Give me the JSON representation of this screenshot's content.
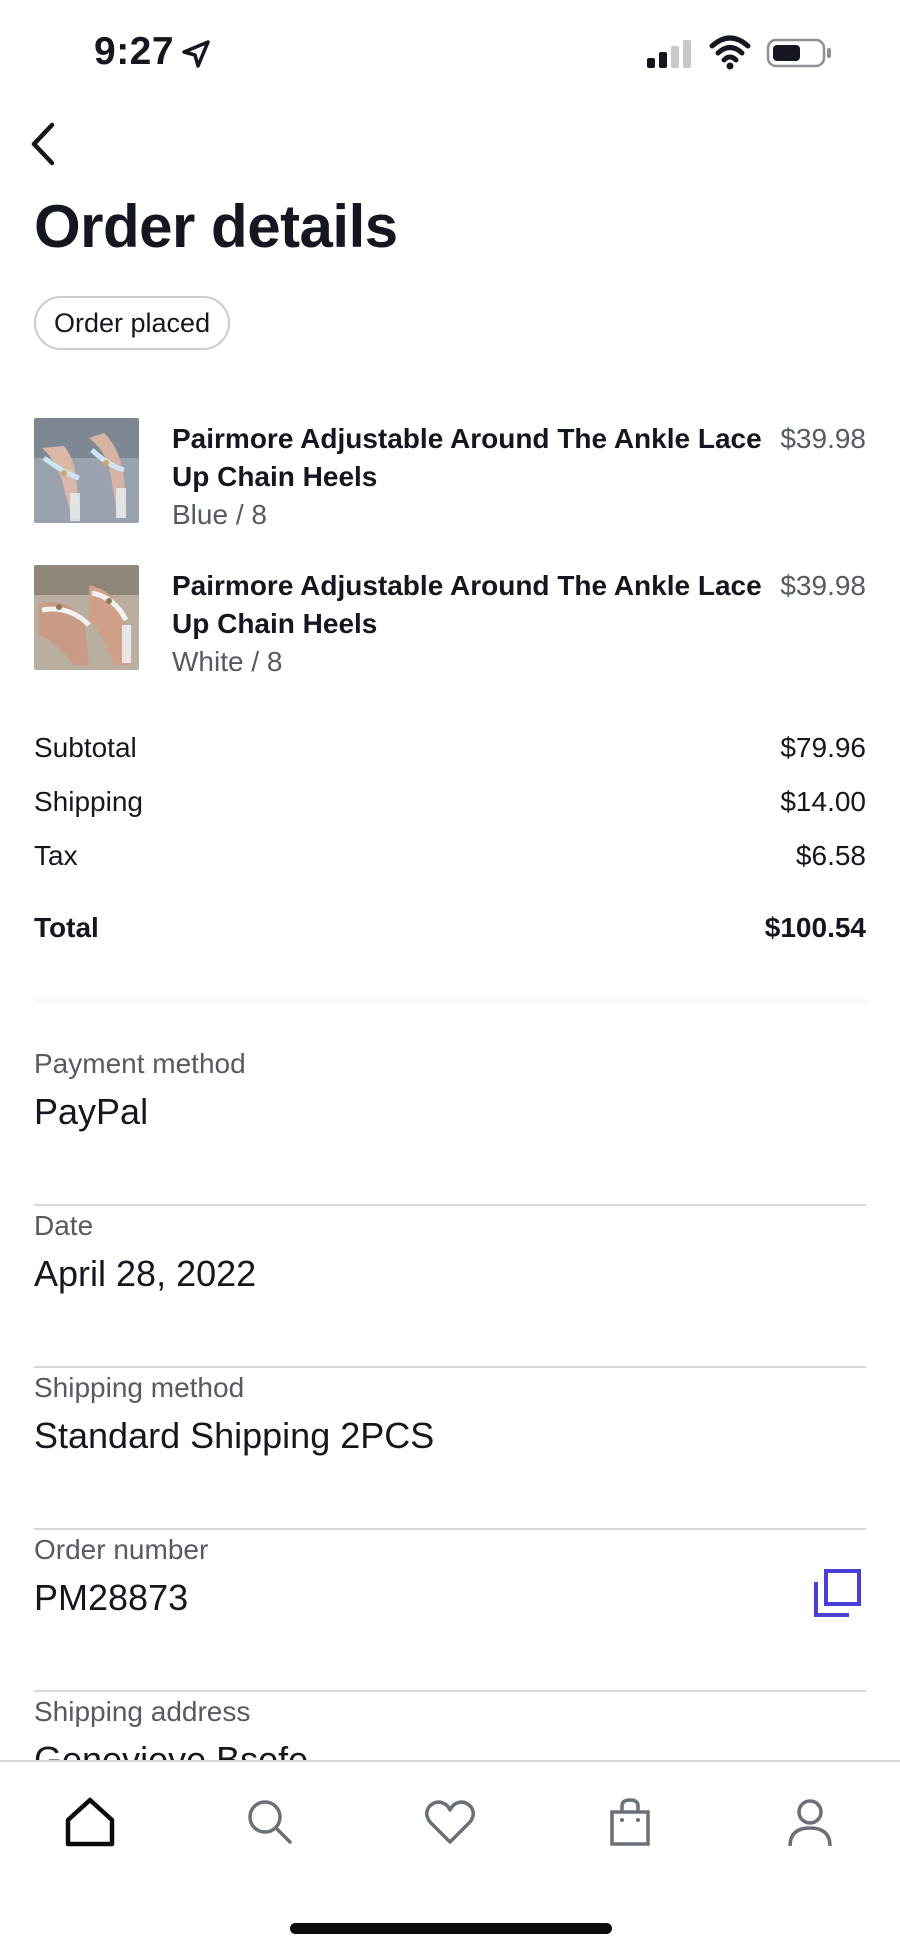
{
  "status_bar": {
    "time": "9:27"
  },
  "header": {
    "title": "Order details",
    "badge": "Order placed"
  },
  "items": [
    {
      "name": "Pairmore Adjustable Around The Ankle Lace Up Chain Heels",
      "variant": "Blue / 8",
      "price": "$39.98"
    },
    {
      "name": "Pairmore Adjustable Around The Ankle Lace Up Chain Heels",
      "variant": "White / 8",
      "price": "$39.98"
    }
  ],
  "summary": {
    "subtotal_label": "Subtotal",
    "subtotal_value": "$79.96",
    "shipping_label": "Shipping",
    "shipping_value": "$14.00",
    "tax_label": "Tax",
    "tax_value": "$6.58",
    "total_label": "Total",
    "total_value": "$100.54"
  },
  "details": {
    "payment_label": "Payment method",
    "payment_value": "PayPal",
    "date_label": "Date",
    "date_value": "April 28, 2022",
    "shipping_method_label": "Shipping method",
    "shipping_method_value": "Standard Shipping 2PCS",
    "order_number_label": "Order number",
    "order_number_value": "PM28873",
    "address_label": "Shipping address",
    "address_value": "Genevieve Bsefe"
  },
  "tabs": [
    "home-icon",
    "search-icon",
    "heart-icon",
    "bag-icon",
    "profile-icon"
  ],
  "colors": {
    "accent": "#4a3fd6",
    "text": "#14171f",
    "muted": "#555a63",
    "divider": "#d6d8dc"
  }
}
